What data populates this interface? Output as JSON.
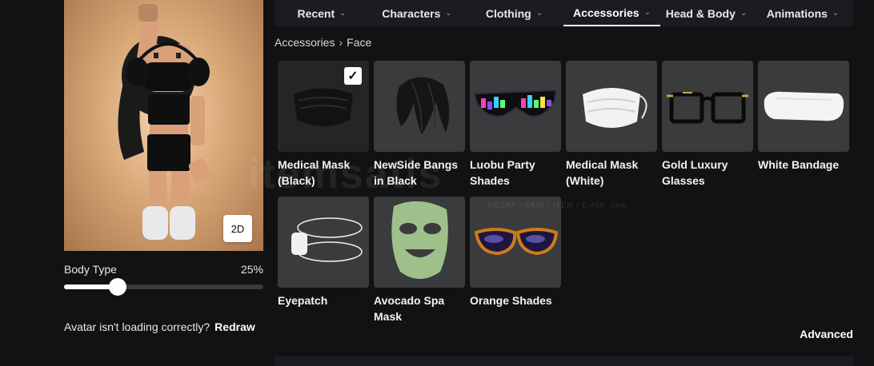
{
  "tabs": [
    {
      "label": "Recent"
    },
    {
      "label": "Characters"
    },
    {
      "label": "Clothing"
    },
    {
      "label": "Accessories"
    },
    {
      "label": "Head & Body"
    },
    {
      "label": "Animations"
    }
  ],
  "breadcrumb": {
    "root": "Accessories",
    "current": "Face"
  },
  "items": [
    {
      "name": "Medical Mask (Black)",
      "selected": true
    },
    {
      "name": "NewSide Bangs in Black",
      "selected": false
    },
    {
      "name": "Luobu Party Shades",
      "selected": false
    },
    {
      "name": "Medical Mask (White)",
      "selected": false
    },
    {
      "name": "Gold Luxury Glasses",
      "selected": false
    },
    {
      "name": "White Bandage",
      "selected": false
    },
    {
      "name": "Eyepatch",
      "selected": false
    },
    {
      "name": "Avocado Spa Mask",
      "selected": false
    },
    {
      "name": "Orange Shades",
      "selected": false
    }
  ],
  "avatar": {
    "view_toggle": "2D"
  },
  "body_type": {
    "label": "Body Type",
    "value_text": "25%",
    "value": 0.27
  },
  "loading": {
    "message": "Avatar isn't loading correctly?",
    "redraw_label": "Redraw"
  },
  "advanced_label": "Advanced",
  "watermark": {
    "text": "itemsatis",
    "sub": "HESAP / SKIN / ITEM / E-PIN .com"
  },
  "icons": {
    "chevron": "chevron-down-icon",
    "check": "checkmark-icon"
  }
}
